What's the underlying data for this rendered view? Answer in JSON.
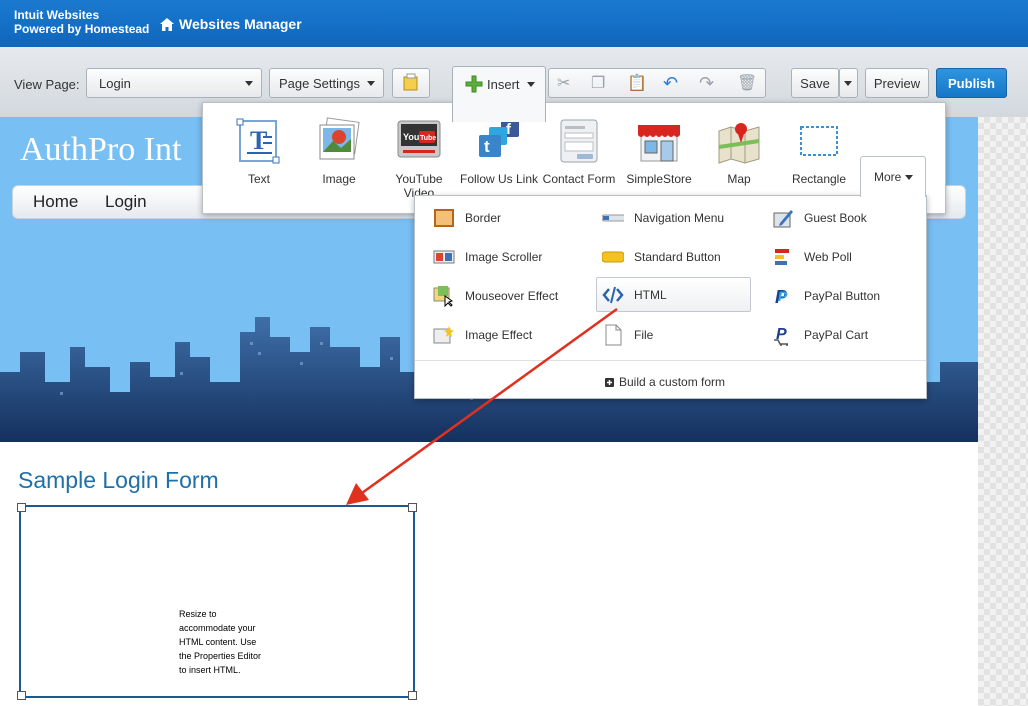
{
  "header": {
    "brand_line1": "Intuit Websites",
    "brand_line2": "Powered by Homestead",
    "manager_title": "Websites Manager"
  },
  "toolbar": {
    "view_page_label": "View Page:",
    "view_page_value": "Login",
    "page_settings_label": "Page Settings",
    "insert_label": "Insert",
    "save_label": "Save",
    "preview_label": "Preview",
    "publish_label": "Publish"
  },
  "insert_panel": {
    "items": [
      {
        "label": "Text",
        "icon": "text-icon"
      },
      {
        "label": "Image",
        "icon": "image-icon"
      },
      {
        "label": "YouTube Video",
        "icon": "youtube-icon"
      },
      {
        "label": "Follow Us Link",
        "icon": "follow-us-icon"
      },
      {
        "label": "Contact Form",
        "icon": "contact-form-icon"
      },
      {
        "label": "SimpleStore",
        "icon": "store-icon"
      },
      {
        "label": "Map",
        "icon": "map-icon"
      },
      {
        "label": "Rectangle",
        "icon": "rectangle-icon"
      }
    ],
    "more_label": "More"
  },
  "more_menu": {
    "col1": [
      "Border",
      "Image Scroller",
      "Mouseover Effect",
      "Image Effect"
    ],
    "col2": [
      "Navigation Menu",
      "Standard Button",
      "HTML",
      "File"
    ],
    "col3": [
      "Guest Book",
      "Web Poll",
      "PayPal Button",
      "PayPal Cart"
    ],
    "custom_form_label": "Build a custom form"
  },
  "site": {
    "title": "AuthPro Int",
    "nav": [
      "Home",
      "Login"
    ],
    "form_title": "Sample Login Form",
    "html_placeholder_lines": [
      "Resize to",
      "accommodate your",
      "HTML content. Use",
      "the Properties Editor",
      "to insert HTML."
    ]
  },
  "colors": {
    "header_blue": "#0f66bc",
    "publish_blue": "#1677c6",
    "sky_blue": "#78bff4",
    "skyline_navy": "#1b3a6b",
    "form_title_blue": "#1f6fa8",
    "arrow_red": "#e0301e"
  }
}
